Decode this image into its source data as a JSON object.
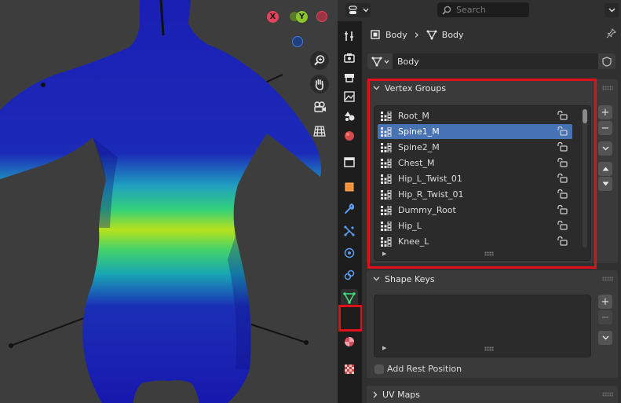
{
  "viewport": {
    "gizmo": {
      "x_label": "X",
      "y_label": "Y"
    },
    "nav_buttons": [
      "zoom-icon",
      "hand-pan-icon",
      "camera-icon",
      "grid-icon"
    ]
  },
  "header": {
    "search_placeholder": "Search"
  },
  "tabs": [
    "tool-icon",
    "render-icon",
    "output-icon",
    "view-layer-icon",
    "scene-icon",
    "world-icon",
    "collection-icon",
    "object-icon",
    "modifier-icon",
    "particles-icon",
    "physics-icon",
    "constraints-icon",
    "object-data-icon",
    "material-icon",
    "texture-icon"
  ],
  "breadcrumb": {
    "object_name": "Body",
    "separator": "›",
    "mesh_name": "Body"
  },
  "data_block": {
    "name": "Body"
  },
  "vertex_groups": {
    "title": "Vertex Groups",
    "items": [
      "Root_M",
      "Spine1_M",
      "Spine2_M",
      "Chest_M",
      "Hip_L_Twist_01",
      "Hip_R_Twist_01",
      "Dummy_Root",
      "Hip_L",
      "Knee_L"
    ],
    "selected_index": 1,
    "add_label": "+",
    "remove_label": "−"
  },
  "shape_keys": {
    "title": "Shape Keys",
    "add_label": "+",
    "remove_label": "−",
    "add_rest_position_label": "Add Rest Position"
  },
  "uv_maps": {
    "title": "UV Maps"
  },
  "colors": {
    "accent": "#4772b3",
    "highlight": "#e0101a",
    "x_axis": "#e2425a",
    "y_axis": "#8bc529",
    "z_axis": "#3f7ae0"
  }
}
